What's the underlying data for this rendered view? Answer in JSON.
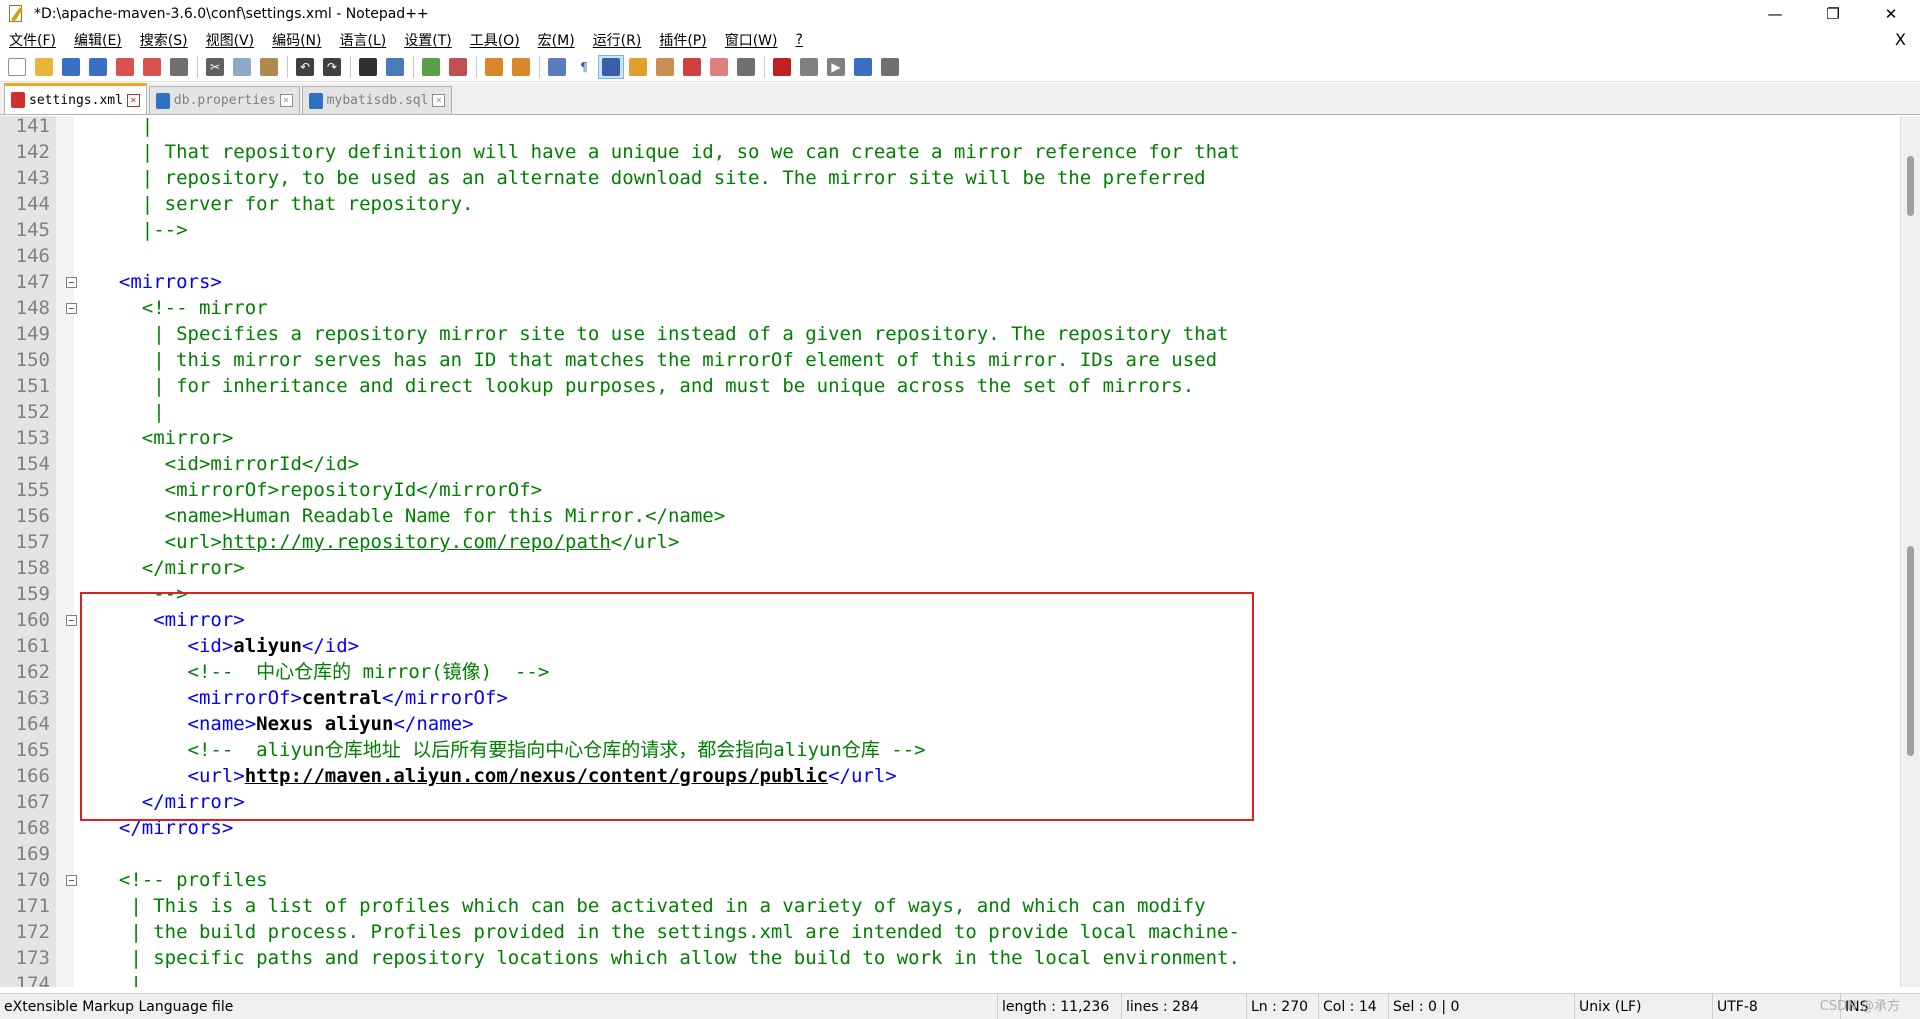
{
  "window": {
    "title": "*D:\\apache-maven-3.6.0\\conf\\settings.xml - Notepad++",
    "controls": {
      "minimize": "—",
      "restore": "❐",
      "close": "✕"
    }
  },
  "menu": {
    "items": [
      "文件(F)",
      "编辑(E)",
      "搜索(S)",
      "视图(V)",
      "编码(N)",
      "语言(L)",
      "设置(T)",
      "工具(O)",
      "宏(M)",
      "运行(R)",
      "插件(P)",
      "窗口(W)",
      "?"
    ],
    "close": "X"
  },
  "tabs": [
    {
      "label": "settings.xml",
      "active": true,
      "icon_color": "#d03030"
    },
    {
      "label": "db.properties",
      "active": false,
      "icon_color": "#3070c0"
    },
    {
      "label": "mybatisdb.sql",
      "active": false,
      "icon_color": "#3070c0"
    }
  ],
  "editor": {
    "lines": [
      {
        "n": "141",
        "segs": [
          {
            "t": "    |",
            "c": "cm"
          }
        ]
      },
      {
        "n": "142",
        "segs": [
          {
            "t": "    | That repository definition will have a unique id, so we can create a mirror reference for that",
            "c": "cm"
          }
        ]
      },
      {
        "n": "143",
        "segs": [
          {
            "t": "    | repository, to be used as an alternate download site. The mirror site will be the preferred",
            "c": "cm"
          }
        ]
      },
      {
        "n": "144",
        "segs": [
          {
            "t": "    | server for that repository.",
            "c": "cm"
          }
        ]
      },
      {
        "n": "145",
        "segs": [
          {
            "t": "    |-->",
            "c": "cm"
          }
        ]
      },
      {
        "n": "146",
        "segs": [
          {
            "t": "",
            "c": "cm"
          }
        ]
      },
      {
        "n": "147",
        "fold": true,
        "segs": [
          {
            "t": "  <mirrors>",
            "c": "tg"
          }
        ]
      },
      {
        "n": "148",
        "fold": true,
        "segs": [
          {
            "t": "    <!-- mirror",
            "c": "cm"
          }
        ]
      },
      {
        "n": "149",
        "segs": [
          {
            "t": "     | Specifies a repository mirror site to use instead of a given repository. The repository that",
            "c": "cm"
          }
        ]
      },
      {
        "n": "150",
        "segs": [
          {
            "t": "     | this mirror serves has an ID that matches the mirrorOf element of this mirror. IDs are used",
            "c": "cm"
          }
        ]
      },
      {
        "n": "151",
        "segs": [
          {
            "t": "     | for inheritance and direct lookup purposes, and must be unique across the set of mirrors.",
            "c": "cm"
          }
        ]
      },
      {
        "n": "152",
        "segs": [
          {
            "t": "     |",
            "c": "cm"
          }
        ]
      },
      {
        "n": "153",
        "segs": [
          {
            "t": "    <mirror>",
            "c": "cm"
          }
        ]
      },
      {
        "n": "154",
        "segs": [
          {
            "t": "      <id>mirrorId</id>",
            "c": "cm"
          }
        ]
      },
      {
        "n": "155",
        "segs": [
          {
            "t": "      <mirrorOf>repositoryId</mirrorOf>",
            "c": "cm"
          }
        ]
      },
      {
        "n": "156",
        "segs": [
          {
            "t": "      <name>Human Readable Name for this Mirror.</name>",
            "c": "cm"
          }
        ]
      },
      {
        "n": "157",
        "segs": [
          {
            "t": "      <url>",
            "c": "cm"
          },
          {
            "t": "http://my.repository.com/repo/path",
            "c": "cm ul"
          },
          {
            "t": "</url>",
            "c": "cm"
          }
        ]
      },
      {
        "n": "158",
        "segs": [
          {
            "t": "    </mirror>",
            "c": "cm"
          }
        ]
      },
      {
        "n": "159",
        "segs": [
          {
            "t": "     -->",
            "c": "cm"
          }
        ]
      },
      {
        "n": "160",
        "fold": true,
        "segs": [
          {
            "t": "     <mirror>",
            "c": "tg"
          }
        ]
      },
      {
        "n": "161",
        "segs": [
          {
            "t": "        <id>",
            "c": "tg"
          },
          {
            "t": "aliyun",
            "c": "tx"
          },
          {
            "t": "</id>",
            "c": "tg"
          }
        ]
      },
      {
        "n": "162",
        "segs": [
          {
            "t": "        <!--  中心仓库的 mirror(镜像)  -->",
            "c": "cm"
          }
        ]
      },
      {
        "n": "163",
        "segs": [
          {
            "t": "        <mirrorOf>",
            "c": "tg"
          },
          {
            "t": "central",
            "c": "tx"
          },
          {
            "t": "</mirrorOf>",
            "c": "tg"
          }
        ]
      },
      {
        "n": "164",
        "segs": [
          {
            "t": "        <name>",
            "c": "tg"
          },
          {
            "t": "Nexus aliyun",
            "c": "tx"
          },
          {
            "t": "</name>",
            "c": "tg"
          }
        ]
      },
      {
        "n": "165",
        "segs": [
          {
            "t": "        <!--  aliyun仓库地址 以后所有要指向中心仓库的请求，都会指向aliyun仓库 -->",
            "c": "cm"
          }
        ]
      },
      {
        "n": "166",
        "segs": [
          {
            "t": "        <url>",
            "c": "tg"
          },
          {
            "t": "http://maven.aliyun.com/nexus/content/groups/public",
            "c": "tx ul"
          },
          {
            "t": "</url>",
            "c": "tg"
          }
        ]
      },
      {
        "n": "167",
        "segs": [
          {
            "t": "    </mirror>",
            "c": "tg"
          }
        ]
      },
      {
        "n": "168",
        "segs": [
          {
            "t": "  </mirrors>",
            "c": "tg"
          }
        ]
      },
      {
        "n": "169",
        "segs": [
          {
            "t": "",
            "c": "cm"
          }
        ]
      },
      {
        "n": "170",
        "fold": true,
        "segs": [
          {
            "t": "  <!-- profiles",
            "c": "cm"
          }
        ]
      },
      {
        "n": "171",
        "segs": [
          {
            "t": "   | This is a list of profiles which can be activated in a variety of ways, and which can modify",
            "c": "cm"
          }
        ]
      },
      {
        "n": "172",
        "segs": [
          {
            "t": "   | the build process. Profiles provided in the settings.xml are intended to provide local machine-",
            "c": "cm"
          }
        ]
      },
      {
        "n": "173",
        "segs": [
          {
            "t": "   | specific paths and repository locations which allow the build to work in the local environment.",
            "c": "cm"
          }
        ]
      },
      {
        "n": "174",
        "segs": [
          {
            "t": "   |",
            "c": "cm"
          }
        ]
      }
    ]
  },
  "status": {
    "filetype": "eXtensible Markup Language file",
    "length": "length : 11,236",
    "lines": "lines : 284",
    "ln": "Ln : 270",
    "col": "Col : 14",
    "sel": "Sel : 0 | 0",
    "eol": "Unix (LF)",
    "encoding": "UTF-8",
    "mode": "INS"
  },
  "watermark": "CSDN @承方"
}
